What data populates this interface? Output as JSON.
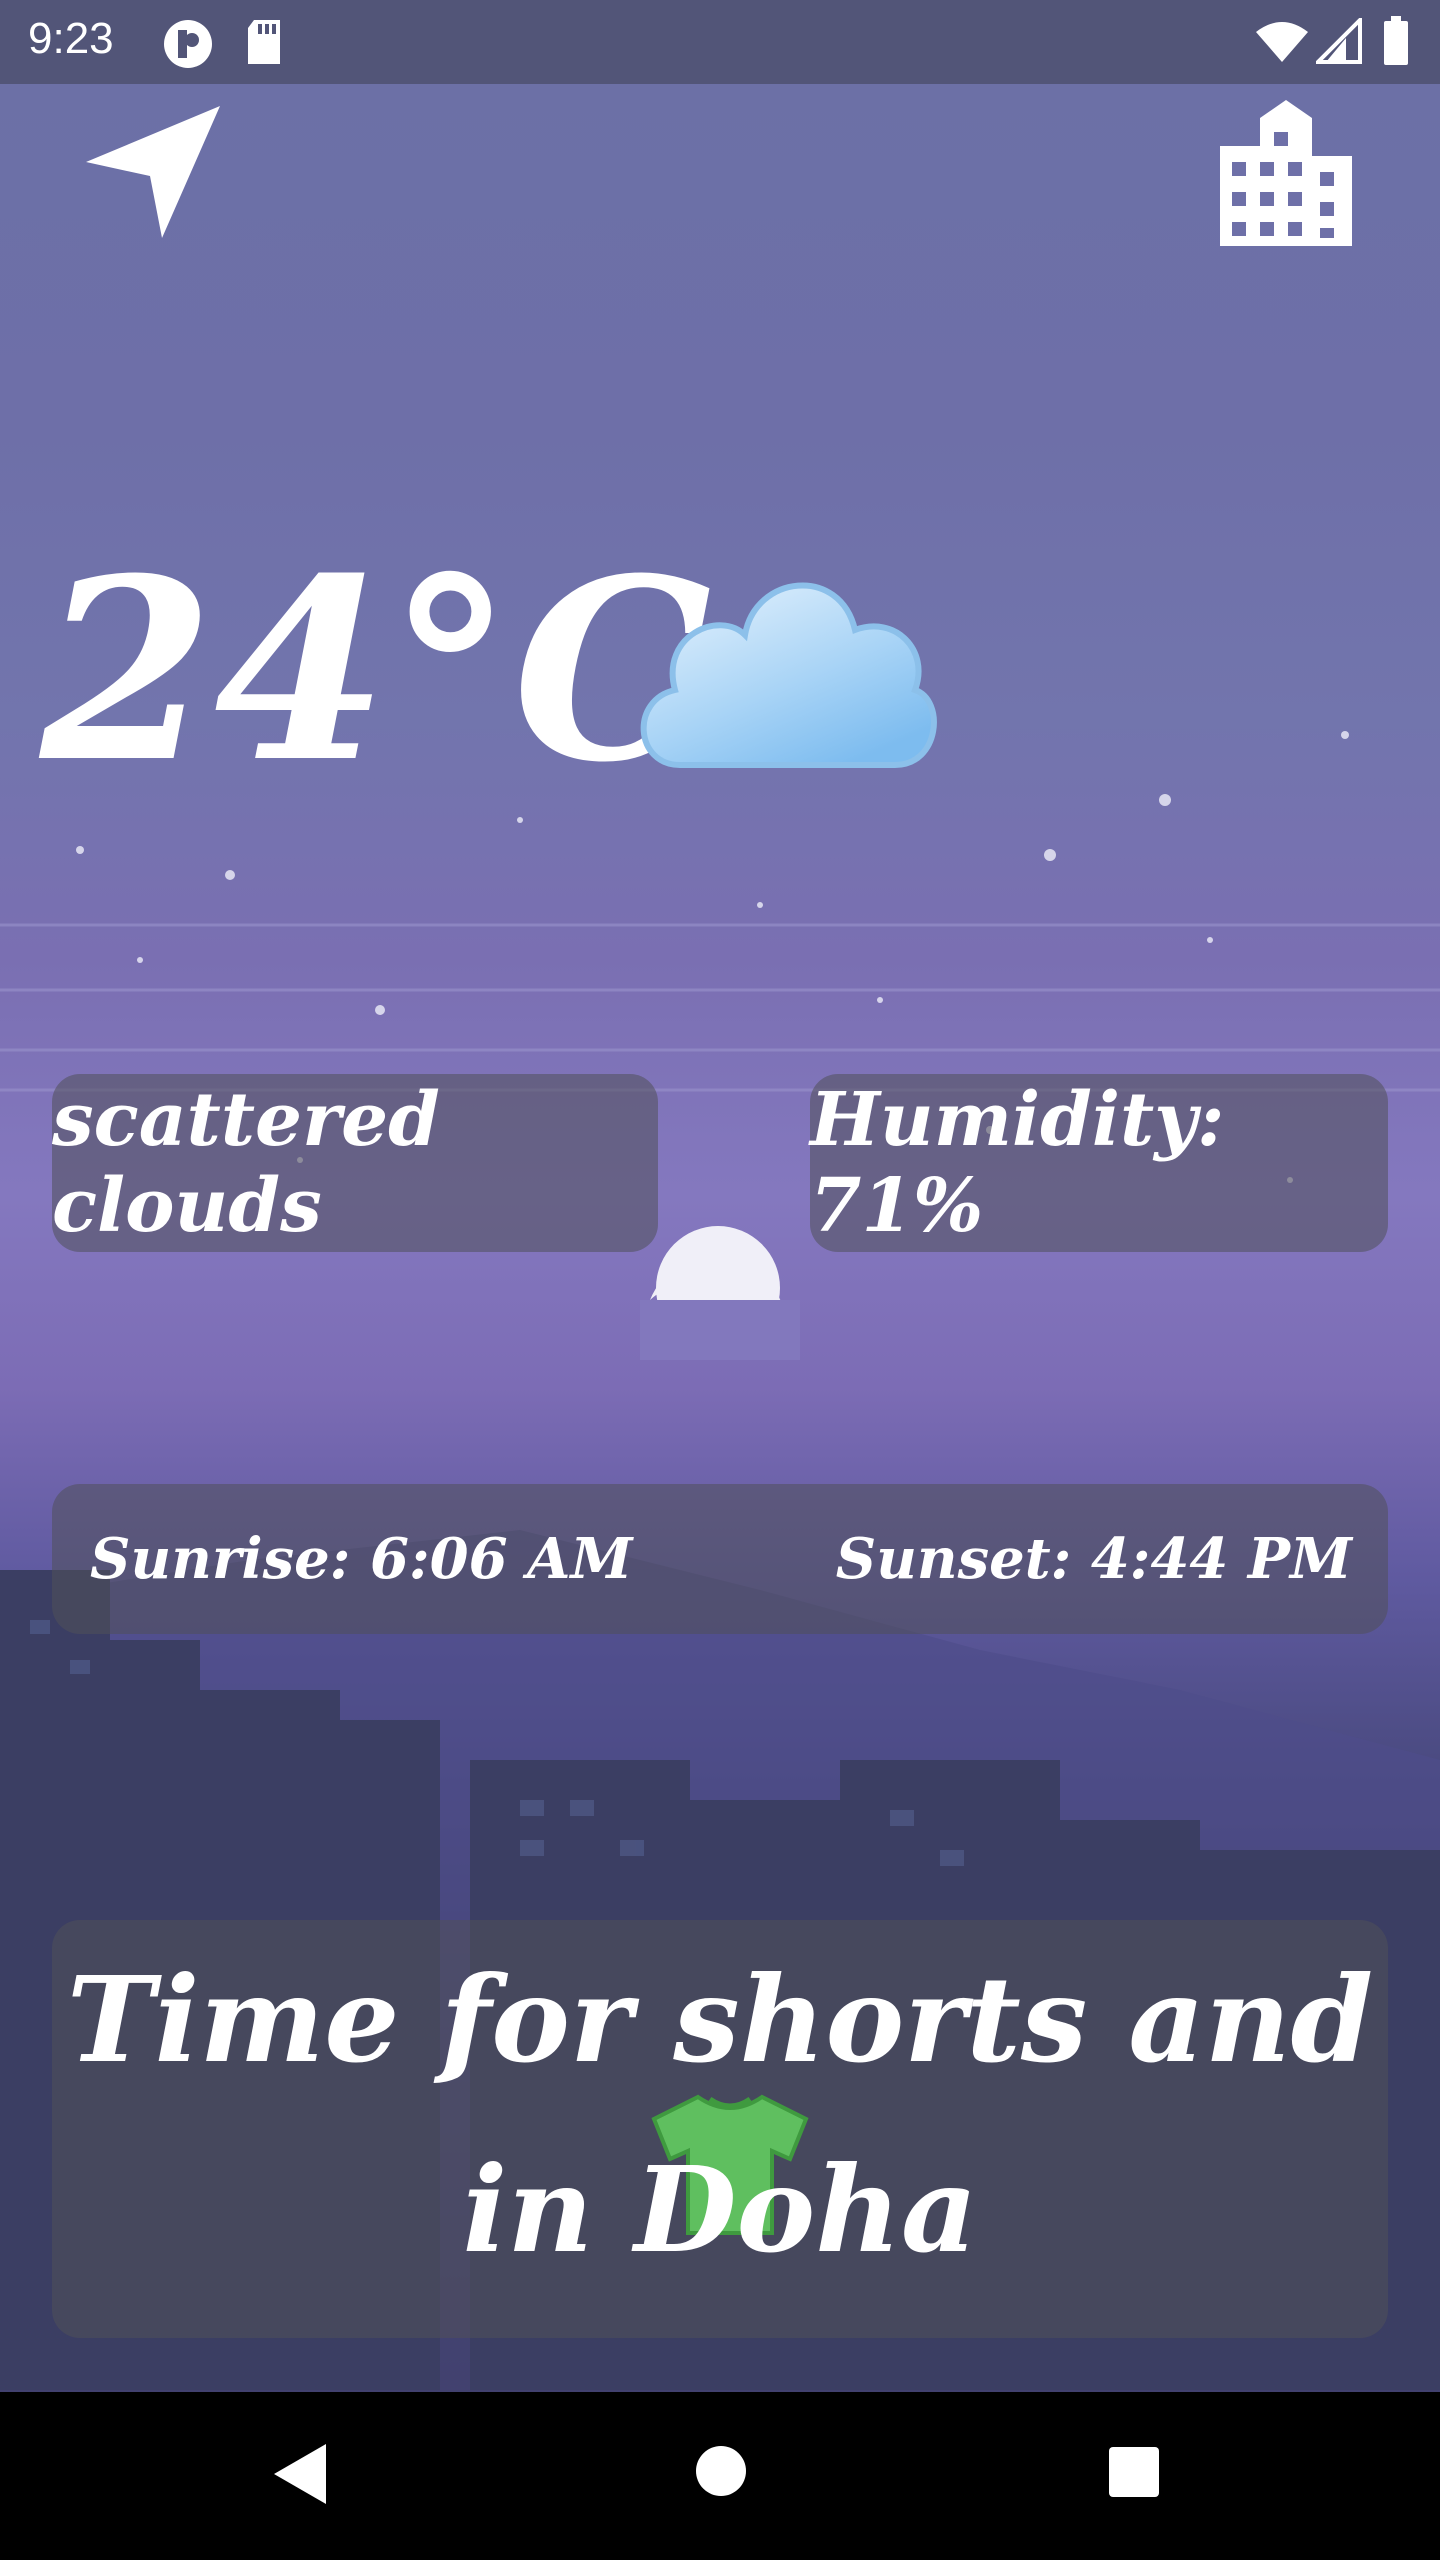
{
  "status_bar": {
    "time": "9:23"
  },
  "weather": {
    "temperature": "24°C",
    "description": "scattered clouds",
    "humidity": "Humidity: 71%",
    "sunrise": "Sunrise: 6:06 AM",
    "sunset": "Sunset: 4:44 PM"
  },
  "advice": {
    "line1": "Time for shorts and",
    "line2": "in Doha"
  },
  "icons": {
    "location": "navigation-arrow-icon",
    "city": "city-buildings-icon",
    "weather": "cloud-icon",
    "clothing": "tshirt-icon"
  }
}
